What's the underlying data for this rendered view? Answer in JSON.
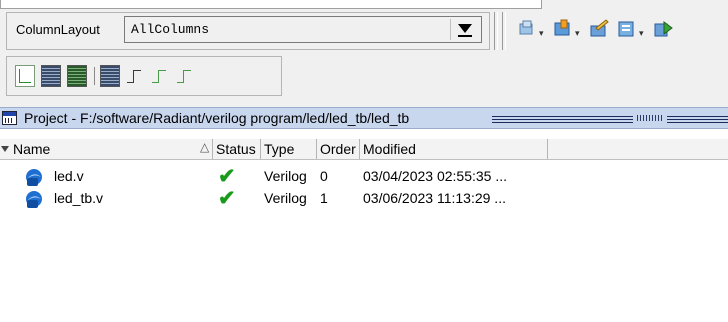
{
  "column_layout": {
    "label": "ColumnLayout",
    "value": "AllColumns"
  },
  "toolbar2": {
    "buttons": [
      "filter-icon",
      "add-file-icon",
      "edit-icon",
      "new-project-icon",
      "run-icon"
    ]
  },
  "pattern_toolbar": {
    "buttons": [
      "waveform-line-icon",
      "waveform-blue-icon",
      "waveform-green-icon",
      "waveform-dark-icon",
      "waveform-step-icon",
      "waveform-step-green-icon",
      "waveform-step-light-icon"
    ]
  },
  "project": {
    "title": "Project - F:/software/Radiant/verilog program/led/led_tb/led_tb"
  },
  "table": {
    "columns": {
      "name": "Name",
      "status": "Status",
      "type": "Type",
      "order": "Order",
      "modified": "Modified"
    },
    "rows": [
      {
        "name": "led.v",
        "status": "ok",
        "type": "Verilog",
        "order": "0",
        "modified": "03/04/2023 02:55:35 ..."
      },
      {
        "name": "led_tb.v",
        "status": "ok",
        "type": "Verilog",
        "order": "1",
        "modified": "03/06/2023 11:13:29 ..."
      }
    ]
  },
  "colors": {
    "titlebar_bg": "#c8d7ee",
    "check_green": "#1a9a1a",
    "file_icon_blue": "#1f6fd0"
  }
}
